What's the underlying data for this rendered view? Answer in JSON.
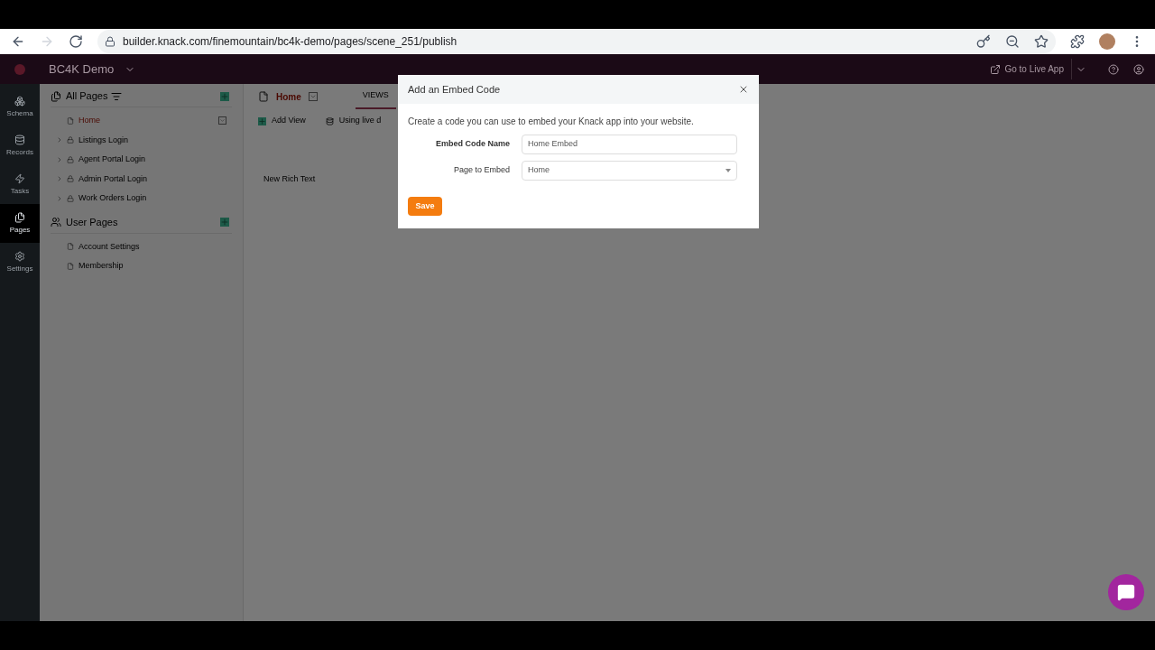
{
  "browser": {
    "url": "builder.knack.com/finemountain/bc4k-demo/pages/scene_251/publish"
  },
  "app": {
    "name": "BC4K Demo",
    "live_button": "Go to Live App"
  },
  "rail": [
    {
      "label": "Schema",
      "selected": false
    },
    {
      "label": "Records",
      "selected": false
    },
    {
      "label": "Tasks",
      "selected": false
    },
    {
      "label": "Pages",
      "selected": true
    },
    {
      "label": "Settings",
      "selected": false
    }
  ],
  "pages_panel": {
    "sections": [
      {
        "title": "All Pages",
        "kind": "all",
        "items": [
          {
            "label": "Home",
            "kind": "page",
            "selected": true
          },
          {
            "label": "Listings Login",
            "kind": "login",
            "selected": false
          },
          {
            "label": "Agent Portal Login",
            "kind": "login",
            "selected": false
          },
          {
            "label": "Admin Portal Login",
            "kind": "login",
            "selected": false
          },
          {
            "label": "Work Orders Login",
            "kind": "login",
            "selected": false
          }
        ]
      },
      {
        "title": "User Pages",
        "kind": "users",
        "items": [
          {
            "label": "Account Settings",
            "kind": "page",
            "selected": false
          },
          {
            "label": "Membership",
            "kind": "page",
            "selected": false
          }
        ]
      }
    ]
  },
  "main": {
    "page_title": "Home",
    "tabs": [
      {
        "label": "VIEWS",
        "selected": true
      }
    ],
    "add_view": "Add View",
    "source": "Using live d",
    "views": [
      "New Rich Text"
    ]
  },
  "modal": {
    "title": "Add an Embed Code",
    "description": "Create a code you can use to embed your Knack app into your website.",
    "fields": [
      {
        "label": "Embed Code Name",
        "kind": "text",
        "value": "Home Embed"
      },
      {
        "label": "Page to Embed",
        "kind": "select",
        "value": "Home"
      }
    ],
    "save": "Save"
  }
}
